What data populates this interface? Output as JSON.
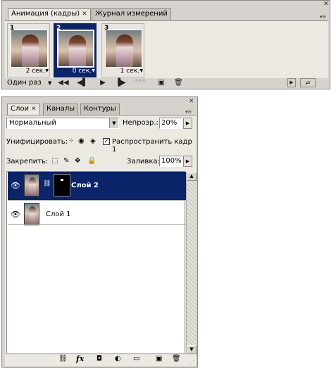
{
  "animation_panel": {
    "tabs": [
      {
        "label": "Анимация (кадры)"
      },
      {
        "label": "Журнал измерений"
      }
    ],
    "frames": [
      {
        "number": "1",
        "delay": "2 сек."
      },
      {
        "number": "2",
        "delay": "0 сек."
      },
      {
        "number": "3",
        "delay": "1 сек."
      }
    ],
    "loop_option": "Один раз"
  },
  "layers_panel": {
    "tabs": [
      {
        "label": "Слои"
      },
      {
        "label": "Каналы"
      },
      {
        "label": "Контуры"
      }
    ],
    "blend_mode": "Нормальный",
    "opacity_label": "Непрозр.:",
    "opacity_value": "20%",
    "unify_label": "Унифицировать:",
    "propagate_label": "Распространить кадр 1",
    "lock_label": "Закрепить:",
    "fill_label": "Заливка:",
    "fill_value": "100%",
    "layers": [
      {
        "name": "Слой 2",
        "selected": true
      },
      {
        "name": "Слой 1",
        "selected": false
      }
    ]
  },
  "colors": {
    "panel_bg": "#d6d3ce",
    "selection": "#0a246a"
  }
}
